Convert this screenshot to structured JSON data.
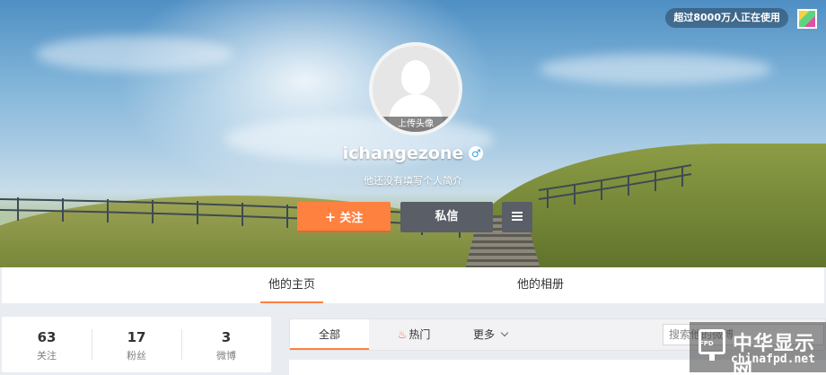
{
  "header": {
    "user_count_badge": "超过8000万人正在使用",
    "skin_icon": "skin-palette-icon"
  },
  "profile": {
    "avatar_upload_label": "上传头像",
    "username": "ichangezone",
    "gender_icon_glyph": "♂",
    "bio": "他还没有填写个人简介",
    "follow_label": "关注",
    "follow_plus": "+",
    "message_label": "私信",
    "more_icon": "menu-icon"
  },
  "tabs": [
    {
      "label": "他的主页",
      "active": true
    },
    {
      "label": "他的相册",
      "active": false
    }
  ],
  "stats": [
    {
      "value": "63",
      "label": "关注"
    },
    {
      "value": "17",
      "label": "粉丝"
    },
    {
      "value": "3",
      "label": "微博"
    }
  ],
  "feed_toolbar": {
    "all_label": "全部",
    "hot_label": "热门",
    "more_label": "更多",
    "search_placeholder": "搜索他的微博"
  },
  "watermark": {
    "logo_text": "FPD",
    "title": "中华显示网",
    "url": "chinafpd.net"
  },
  "colors": {
    "accent": "#ff8140",
    "dark_button": "#5a5e66",
    "gender_blue": "#3aa0e8"
  }
}
